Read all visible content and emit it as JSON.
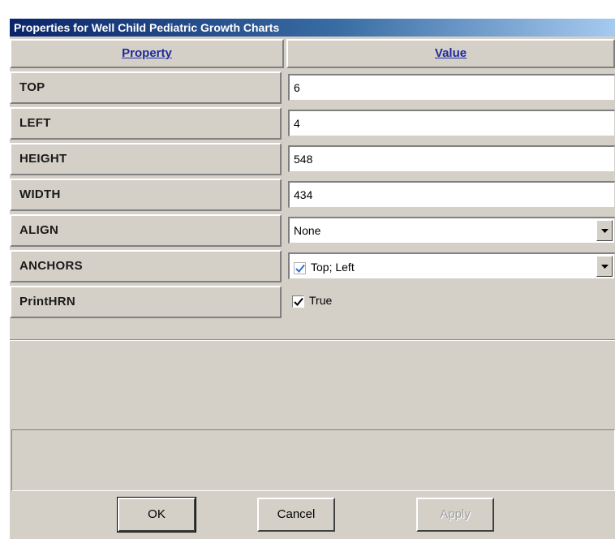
{
  "window": {
    "title": "Properties for Well Child Pediatric Growth Charts"
  },
  "grid": {
    "header": {
      "property": "Property",
      "value": "Value"
    },
    "rows": [
      {
        "property": "TOP",
        "value": "6"
      },
      {
        "property": "LEFT",
        "value": "4"
      },
      {
        "property": "HEIGHT",
        "value": "548"
      },
      {
        "property": "WIDTH",
        "value": "434"
      },
      {
        "property": "ALIGN",
        "value": "None"
      },
      {
        "property": "ANCHORS",
        "value": "Top; Left"
      },
      {
        "property": "PrintHRN",
        "value": "True"
      }
    ]
  },
  "buttons": {
    "ok": "OK",
    "cancel": "Cancel",
    "apply": "Apply"
  },
  "icons": {
    "dropdown": "chevron-down-icon",
    "anchors_check": "checkmark-icon",
    "printhrn_check": "checkbox-checked-icon"
  },
  "colors": {
    "title_gradient_start": "#0a246a",
    "title_gradient_end": "#a6caf0",
    "header_text": "#1f2a9b",
    "face": "#d4d0c8",
    "anchor_check": "#2f6fd0"
  }
}
